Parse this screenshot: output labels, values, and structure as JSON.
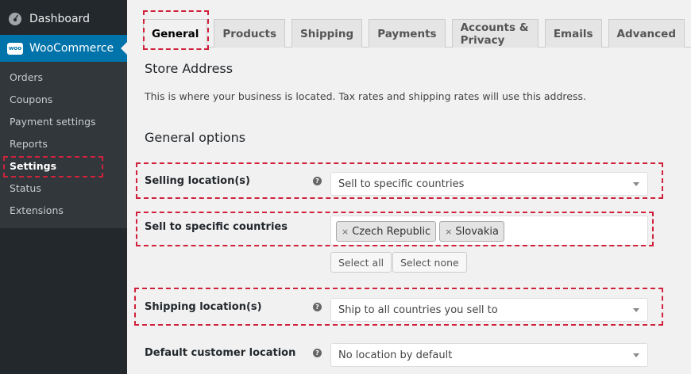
{
  "sidebar": {
    "dashboard": "Dashboard",
    "woocommerce": "WooCommerce",
    "woo_logo_text": "woo",
    "items": [
      {
        "label": "Orders"
      },
      {
        "label": "Coupons"
      },
      {
        "label": "Payment settings"
      },
      {
        "label": "Reports"
      },
      {
        "label": "Settings"
      },
      {
        "label": "Status"
      },
      {
        "label": "Extensions"
      }
    ]
  },
  "tabs": [
    "General",
    "Products",
    "Shipping",
    "Payments",
    "Accounts & Privacy",
    "Emails",
    "Advanced"
  ],
  "active_tab": "General",
  "store_address": {
    "title": "Store Address",
    "description": "This is where your business is located. Tax rates and shipping rates will use this address."
  },
  "general_options": {
    "title": "General options",
    "help_icon": "?",
    "selling_location": {
      "label": "Selling location(s)",
      "value": "Sell to specific countries"
    },
    "specific_countries": {
      "label": "Sell to specific countries",
      "chips": [
        "Czech Republic",
        "Slovakia"
      ],
      "select_all": "Select all",
      "select_none": "Select none"
    },
    "shipping_location": {
      "label": "Shipping location(s)",
      "value": "Ship to all countries you sell to"
    },
    "default_location": {
      "label": "Default customer location",
      "value": "No location by default"
    }
  },
  "colors": {
    "sidebar_bg": "#23282d",
    "accent": "#0073aa",
    "highlight": "#d0213d"
  }
}
